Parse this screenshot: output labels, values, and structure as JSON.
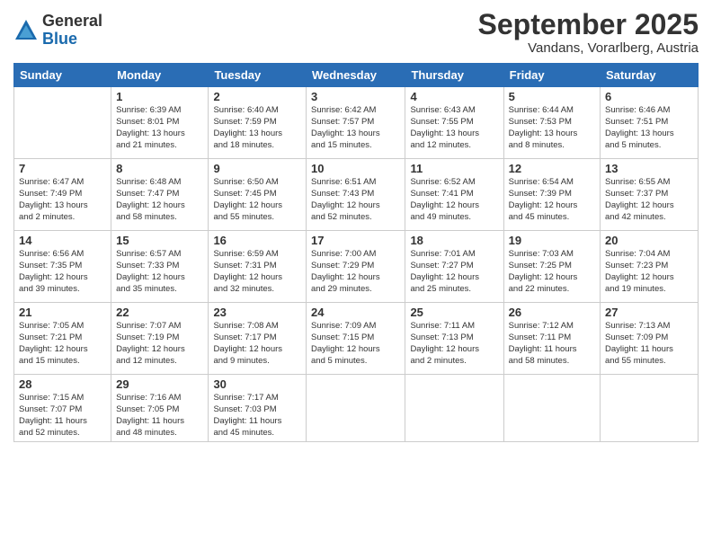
{
  "logo": {
    "general": "General",
    "blue": "Blue"
  },
  "title": "September 2025",
  "location": "Vandans, Vorarlberg, Austria",
  "days_header": [
    "Sunday",
    "Monday",
    "Tuesday",
    "Wednesday",
    "Thursday",
    "Friday",
    "Saturday"
  ],
  "weeks": [
    [
      {
        "day": "",
        "info": ""
      },
      {
        "day": "1",
        "info": "Sunrise: 6:39 AM\nSunset: 8:01 PM\nDaylight: 13 hours\nand 21 minutes."
      },
      {
        "day": "2",
        "info": "Sunrise: 6:40 AM\nSunset: 7:59 PM\nDaylight: 13 hours\nand 18 minutes."
      },
      {
        "day": "3",
        "info": "Sunrise: 6:42 AM\nSunset: 7:57 PM\nDaylight: 13 hours\nand 15 minutes."
      },
      {
        "day": "4",
        "info": "Sunrise: 6:43 AM\nSunset: 7:55 PM\nDaylight: 13 hours\nand 12 minutes."
      },
      {
        "day": "5",
        "info": "Sunrise: 6:44 AM\nSunset: 7:53 PM\nDaylight: 13 hours\nand 8 minutes."
      },
      {
        "day": "6",
        "info": "Sunrise: 6:46 AM\nSunset: 7:51 PM\nDaylight: 13 hours\nand 5 minutes."
      }
    ],
    [
      {
        "day": "7",
        "info": "Sunrise: 6:47 AM\nSunset: 7:49 PM\nDaylight: 13 hours\nand 2 minutes."
      },
      {
        "day": "8",
        "info": "Sunrise: 6:48 AM\nSunset: 7:47 PM\nDaylight: 12 hours\nand 58 minutes."
      },
      {
        "day": "9",
        "info": "Sunrise: 6:50 AM\nSunset: 7:45 PM\nDaylight: 12 hours\nand 55 minutes."
      },
      {
        "day": "10",
        "info": "Sunrise: 6:51 AM\nSunset: 7:43 PM\nDaylight: 12 hours\nand 52 minutes."
      },
      {
        "day": "11",
        "info": "Sunrise: 6:52 AM\nSunset: 7:41 PM\nDaylight: 12 hours\nand 49 minutes."
      },
      {
        "day": "12",
        "info": "Sunrise: 6:54 AM\nSunset: 7:39 PM\nDaylight: 12 hours\nand 45 minutes."
      },
      {
        "day": "13",
        "info": "Sunrise: 6:55 AM\nSunset: 7:37 PM\nDaylight: 12 hours\nand 42 minutes."
      }
    ],
    [
      {
        "day": "14",
        "info": "Sunrise: 6:56 AM\nSunset: 7:35 PM\nDaylight: 12 hours\nand 39 minutes."
      },
      {
        "day": "15",
        "info": "Sunrise: 6:57 AM\nSunset: 7:33 PM\nDaylight: 12 hours\nand 35 minutes."
      },
      {
        "day": "16",
        "info": "Sunrise: 6:59 AM\nSunset: 7:31 PM\nDaylight: 12 hours\nand 32 minutes."
      },
      {
        "day": "17",
        "info": "Sunrise: 7:00 AM\nSunset: 7:29 PM\nDaylight: 12 hours\nand 29 minutes."
      },
      {
        "day": "18",
        "info": "Sunrise: 7:01 AM\nSunset: 7:27 PM\nDaylight: 12 hours\nand 25 minutes."
      },
      {
        "day": "19",
        "info": "Sunrise: 7:03 AM\nSunset: 7:25 PM\nDaylight: 12 hours\nand 22 minutes."
      },
      {
        "day": "20",
        "info": "Sunrise: 7:04 AM\nSunset: 7:23 PM\nDaylight: 12 hours\nand 19 minutes."
      }
    ],
    [
      {
        "day": "21",
        "info": "Sunrise: 7:05 AM\nSunset: 7:21 PM\nDaylight: 12 hours\nand 15 minutes."
      },
      {
        "day": "22",
        "info": "Sunrise: 7:07 AM\nSunset: 7:19 PM\nDaylight: 12 hours\nand 12 minutes."
      },
      {
        "day": "23",
        "info": "Sunrise: 7:08 AM\nSunset: 7:17 PM\nDaylight: 12 hours\nand 9 minutes."
      },
      {
        "day": "24",
        "info": "Sunrise: 7:09 AM\nSunset: 7:15 PM\nDaylight: 12 hours\nand 5 minutes."
      },
      {
        "day": "25",
        "info": "Sunrise: 7:11 AM\nSunset: 7:13 PM\nDaylight: 12 hours\nand 2 minutes."
      },
      {
        "day": "26",
        "info": "Sunrise: 7:12 AM\nSunset: 7:11 PM\nDaylight: 11 hours\nand 58 minutes."
      },
      {
        "day": "27",
        "info": "Sunrise: 7:13 AM\nSunset: 7:09 PM\nDaylight: 11 hours\nand 55 minutes."
      }
    ],
    [
      {
        "day": "28",
        "info": "Sunrise: 7:15 AM\nSunset: 7:07 PM\nDaylight: 11 hours\nand 52 minutes."
      },
      {
        "day": "29",
        "info": "Sunrise: 7:16 AM\nSunset: 7:05 PM\nDaylight: 11 hours\nand 48 minutes."
      },
      {
        "day": "30",
        "info": "Sunrise: 7:17 AM\nSunset: 7:03 PM\nDaylight: 11 hours\nand 45 minutes."
      },
      {
        "day": "",
        "info": ""
      },
      {
        "day": "",
        "info": ""
      },
      {
        "day": "",
        "info": ""
      },
      {
        "day": "",
        "info": ""
      }
    ]
  ]
}
